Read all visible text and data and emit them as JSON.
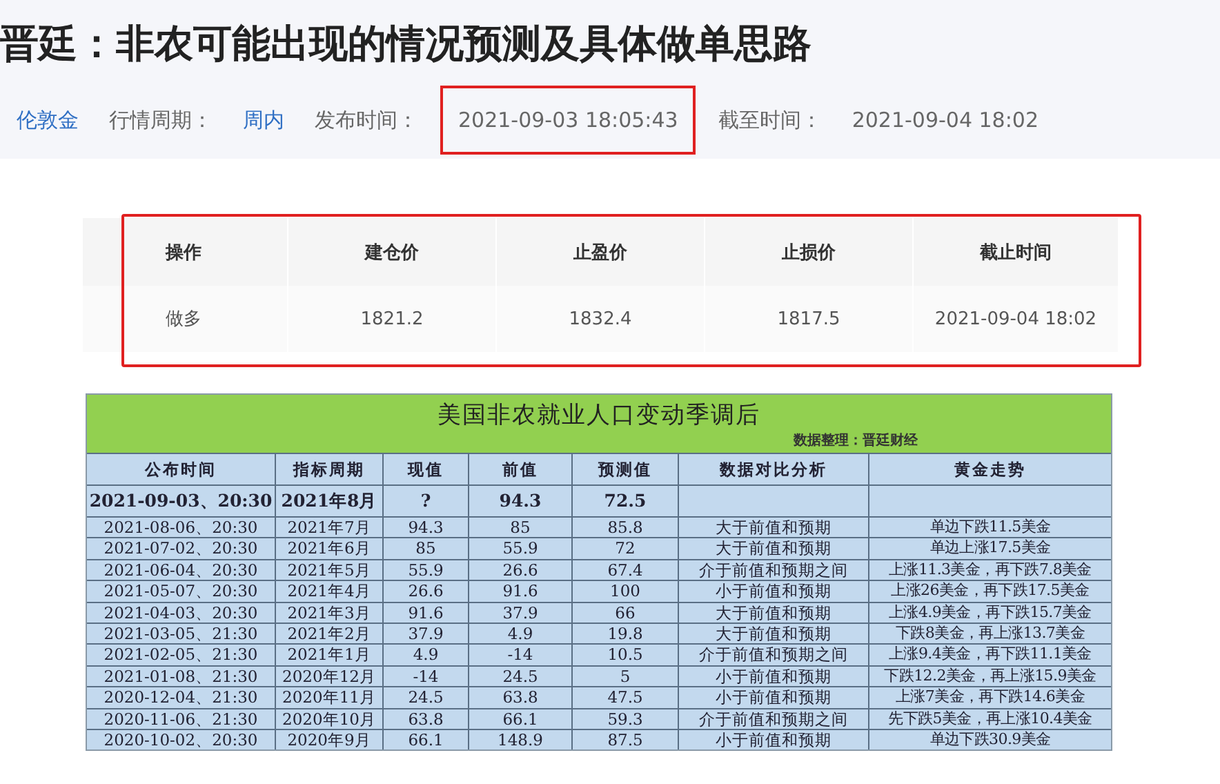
{
  "header": {
    "title": "晋廷：非农可能出现的情况预测及具体做单思路",
    "meta": [
      {
        "kind": "link",
        "text": "伦敦金",
        "highlighted": false
      },
      {
        "kind": "label",
        "text": "行情周期：",
        "highlighted": false
      },
      {
        "kind": "link",
        "text": "周内",
        "highlighted": false
      },
      {
        "kind": "label",
        "text": "发布时间：",
        "highlighted": false
      },
      {
        "kind": "value",
        "text": "2021-09-03 18:05:43",
        "highlighted": true
      },
      {
        "kind": "label",
        "text": "截至时间：",
        "highlighted": false
      },
      {
        "kind": "value",
        "text": "2021-09-04 18:02",
        "highlighted": false
      }
    ]
  },
  "trade_table": {
    "highlighted": true,
    "columns": [
      "操作",
      "建仓价",
      "止盈价",
      "止损价",
      "截止时间"
    ],
    "rows": [
      [
        "做多",
        "1821.2",
        "1832.4",
        "1817.5",
        "2021-09-04 18:02"
      ]
    ]
  },
  "nfp_table": {
    "title": "美国非农就业人口变动季调后",
    "source": "数据整理：晋廷财经",
    "columns": [
      "公布时间",
      "指标周期",
      "现值",
      "前值",
      "预测值",
      "数据对比分析",
      "黄金走势"
    ],
    "rows": [
      {
        "emphasized": true,
        "cells": [
          "2021-09-03、20:30",
          "2021年8月",
          "?",
          "94.3",
          "72.5",
          "",
          ""
        ]
      },
      {
        "emphasized": false,
        "cells": [
          "2021-08-06、20:30",
          "2021年7月",
          "94.3",
          "85",
          "85.8",
          "大于前值和预期",
          "单边下跌11.5美金"
        ]
      },
      {
        "emphasized": false,
        "cells": [
          "2021-07-02、20:30",
          "2021年6月",
          "85",
          "55.9",
          "72",
          "大于前值和预期",
          "单边上涨17.5美金"
        ]
      },
      {
        "emphasized": false,
        "cells": [
          "2021-06-04、20:30",
          "2021年5月",
          "55.9",
          "26.6",
          "67.4",
          "介于前值和预期之间",
          "上涨11.3美金，再下跌7.8美金"
        ]
      },
      {
        "emphasized": false,
        "cells": [
          "2021-05-07、20:30",
          "2021年4月",
          "26.6",
          "91.6",
          "100",
          "小于前值和预期",
          "上涨26美金，再下跌17.5美金"
        ]
      },
      {
        "emphasized": false,
        "cells": [
          "2021-04-03、20:30",
          "2021年3月",
          "91.6",
          "37.9",
          "66",
          "大于前值和预期",
          "上涨4.9美金，再下跌15.7美金"
        ]
      },
      {
        "emphasized": false,
        "cells": [
          "2021-03-05、21:30",
          "2021年2月",
          "37.9",
          "4.9",
          "19.8",
          "大于前值和预期",
          "下跌8美金，再上涨13.7美金"
        ]
      },
      {
        "emphasized": false,
        "cells": [
          "2021-02-05、21:30",
          "2021年1月",
          "4.9",
          "-14",
          "10.5",
          "介于前值和预期之间",
          "上涨9.4美金，再下跌11.1美金"
        ]
      },
      {
        "emphasized": false,
        "cells": [
          "2021-01-08、21:30",
          "2020年12月",
          "-14",
          "24.5",
          "5",
          "小于前值和预期",
          "下跌12.2美金，再上涨15.9美金"
        ]
      },
      {
        "emphasized": false,
        "cells": [
          "2020-12-04、21:30",
          "2020年11月",
          "24.5",
          "63.8",
          "47.5",
          "小于前值和预期",
          "上涨7美金，再下跌14.6美金"
        ]
      },
      {
        "emphasized": false,
        "cells": [
          "2020-11-06、21:30",
          "2020年10月",
          "63.8",
          "66.1",
          "59.3",
          "介于前值和预期之间",
          "先下跌5美金，再上涨10.4美金"
        ]
      },
      {
        "emphasized": false,
        "cells": [
          "2020-10-02、20:30",
          "2020年9月",
          "66.1",
          "148.9",
          "87.5",
          "小于前值和预期",
          "单边下跌30.9美金"
        ]
      }
    ]
  }
}
